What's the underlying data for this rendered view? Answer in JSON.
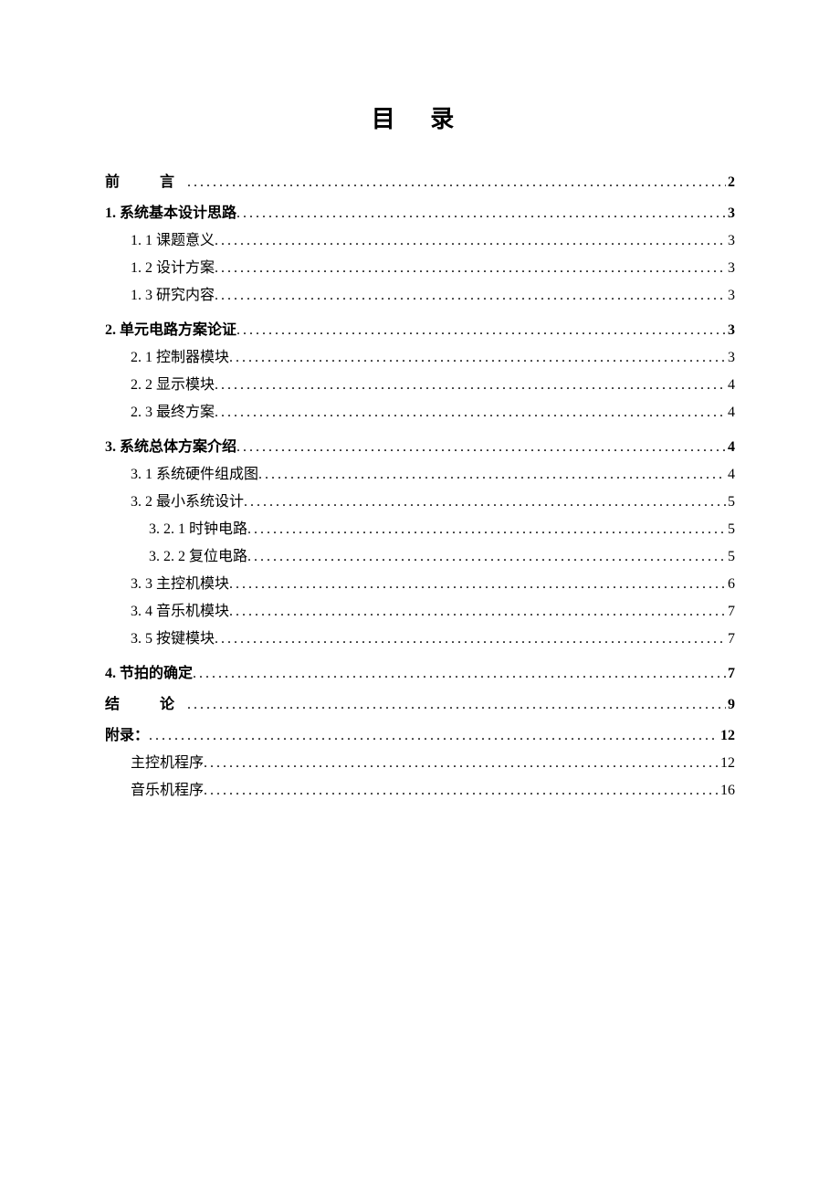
{
  "title": "目 录",
  "entries": [
    {
      "label": "前　言",
      "page": "2",
      "level": 0,
      "bold": true,
      "spaced": true
    },
    {
      "label": "1. 系统基本设计思路",
      "page": "3",
      "level": 0,
      "bold": true,
      "sectionTop": true
    },
    {
      "label": "1. 1 课题意义",
      "page": "3",
      "level": 1
    },
    {
      "label": "1. 2 设计方案",
      "page": "3",
      "level": 1
    },
    {
      "label": "1. 3 研究内容",
      "page": "3",
      "level": 1
    },
    {
      "label": "2. 单元电路方案论证",
      "page": "3",
      "level": 0,
      "bold": true,
      "afterGroup": true
    },
    {
      "label": "2. 1 控制器模块",
      "page": "3",
      "level": 1
    },
    {
      "label": "2. 2 显示模块",
      "page": "4",
      "level": 1
    },
    {
      "label": "2. 3 最终方案",
      "page": "4",
      "level": 1
    },
    {
      "label": "3. 系统总体方案介绍",
      "page": "4",
      "level": 0,
      "bold": true,
      "afterGroup": true
    },
    {
      "label": "3. 1  系统硬件组成图",
      "page": "4",
      "level": 1
    },
    {
      "label": "3. 2 最小系统设计",
      "page": "5",
      "level": 1
    },
    {
      "label": "3. 2. 1  时钟电路",
      "page": "5",
      "level": 2
    },
    {
      "label": "3. 2. 2  复位电路",
      "page": "5",
      "level": 2
    },
    {
      "label": "3. 3 主控机模块",
      "page": "6",
      "level": 1
    },
    {
      "label": "3. 4 音乐机模块",
      "page": "7",
      "level": 1
    },
    {
      "label": "3. 5 按键模块",
      "page": "7",
      "level": 1
    },
    {
      "label": "4. 节拍的确定",
      "page": "7",
      "level": 0,
      "bold": true,
      "afterGroup": true
    },
    {
      "label": "结　论",
      "page": "9",
      "level": 0,
      "bold": true,
      "spaced": true,
      "sectionTop": true
    },
    {
      "label": "附录：",
      "page": "12",
      "level": 0,
      "bold": true,
      "sectionTop": true
    },
    {
      "label": "主控机程序",
      "page": "12",
      "level": 1
    },
    {
      "label": "音乐机程序",
      "page": "16",
      "level": 1
    }
  ]
}
